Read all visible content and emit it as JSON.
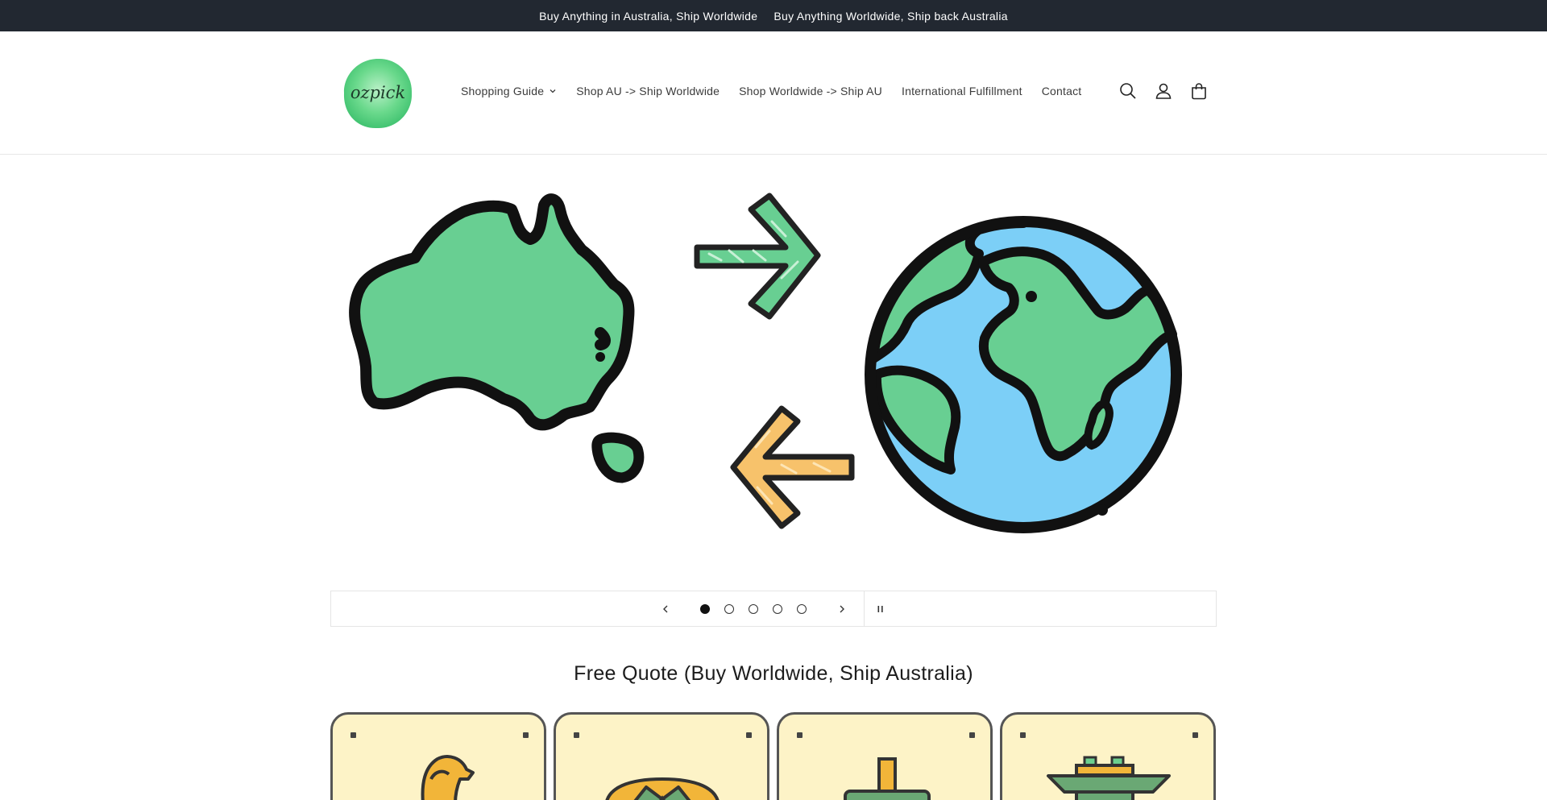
{
  "announcement": {
    "left": "Buy Anything in Australia, Ship Worldwide",
    "right": "Buy Anything Worldwide, Ship back Australia"
  },
  "logo": {
    "text": "ozpick",
    "alt": "ozpick"
  },
  "nav": {
    "items": [
      {
        "label": "Shopping Guide"
      },
      {
        "label": "Shop AU -> Ship Worldwide"
      },
      {
        "label": "Shop Worldwide -> Ship AU"
      },
      {
        "label": "International Fulfillment"
      },
      {
        "label": "Contact"
      }
    ]
  },
  "header_icons": [
    "search-icon",
    "account-icon",
    "cart-icon"
  ],
  "slider": {
    "total_slides": 5,
    "active_slide": 1
  },
  "section": {
    "title": "Free Quote (Buy Worldwide, Ship Australia)"
  },
  "cards": [
    {
      "icon": "merlion-icon"
    },
    {
      "icon": "durian-icon"
    },
    {
      "icon": "tower-icon"
    },
    {
      "icon": "pagoda-icon"
    }
  ],
  "colors": {
    "announcement_bg": "#222831",
    "map_green": "#68cf92",
    "ocean_blue": "#7ccff7",
    "arrow_orange": "#f7c26b",
    "card_bg": "#fdf3c7"
  }
}
